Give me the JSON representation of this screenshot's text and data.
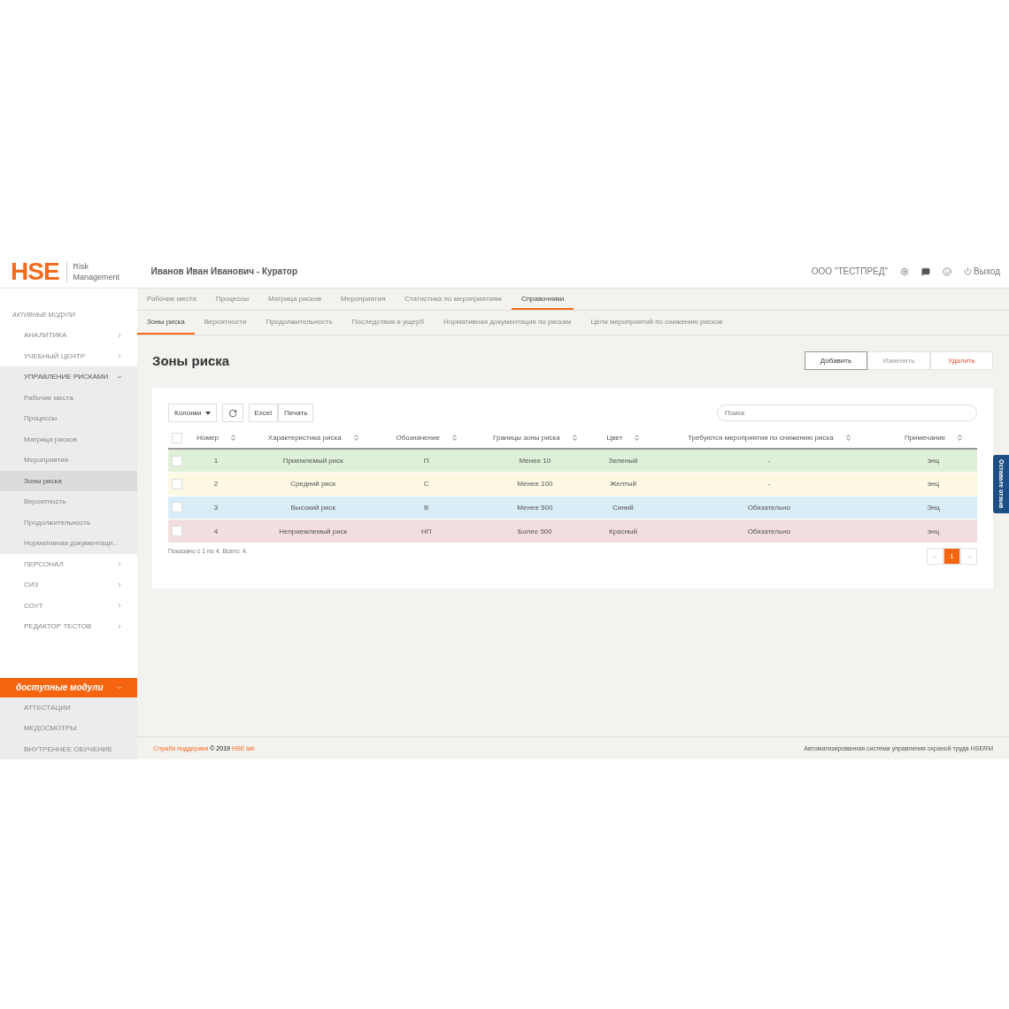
{
  "header": {
    "logo": "HSE",
    "logo_sub": "Risk Management",
    "user": "Иванов Иван Иванович - Куратор",
    "org": "ООО \"ТЕСТПРЕД\"",
    "logout": "Выход"
  },
  "sidebar": {
    "title": "АКТИВНЫЕ МОДУЛИ",
    "items": [
      {
        "label": "АНАЛИТИКА",
        "expanded": false
      },
      {
        "label": "УЧЕБНЫЙ ЦЕНТР",
        "expanded": false
      },
      {
        "label": "УПРАВЛЕНИЕ РИСКАМИ",
        "expanded": true,
        "children": [
          {
            "label": "Рабочие места",
            "selected": false
          },
          {
            "label": "Процессы",
            "selected": false
          },
          {
            "label": "Матрица рисков",
            "selected": false
          },
          {
            "label": "Мероприятия",
            "selected": false
          },
          {
            "label": "Зоны риска",
            "selected": true
          },
          {
            "label": "Вероятность",
            "selected": false
          },
          {
            "label": "Продолжительность",
            "selected": false
          },
          {
            "label": "Нормативная документаци...",
            "selected": false
          }
        ]
      },
      {
        "label": "ПЕРСОНАЛ",
        "expanded": false
      },
      {
        "label": "СИЗ",
        "expanded": false
      },
      {
        "label": "СОУТ",
        "expanded": false
      },
      {
        "label": "РЕДАКТОР ТЕСТОВ",
        "expanded": false
      }
    ],
    "available": {
      "title": "доступные модули",
      "items": [
        "АТТЕСТАЦИИ",
        "МЕДОСМОТРЫ",
        "ВНУТРЕННЕЕ ОБУЧЕНИЕ"
      ]
    }
  },
  "tabs": [
    {
      "label": "Рабочие места",
      "selected": false
    },
    {
      "label": "Процессы",
      "selected": false
    },
    {
      "label": "Матрица рисков",
      "selected": false
    },
    {
      "label": "Мероприятия",
      "selected": false
    },
    {
      "label": "Статистика по мероприятиям",
      "selected": false
    },
    {
      "label": "Справочники",
      "selected": true
    }
  ],
  "subtabs": [
    {
      "label": "Зоны риска",
      "selected": true
    },
    {
      "label": "Вероятности",
      "selected": false
    },
    {
      "label": "Продолжительность",
      "selected": false
    },
    {
      "label": "Последствия и ущерб",
      "selected": false
    },
    {
      "label": "Нормативная документация по рискам",
      "selected": false
    },
    {
      "label": "Цели мероприятий по снижению рисков",
      "selected": false
    }
  ],
  "page_title": "Зоны риска",
  "actions": [
    {
      "label": "Добавить",
      "kind": "primary"
    },
    {
      "label": "Изменить",
      "kind": "muted"
    },
    {
      "label": "Удалить",
      "kind": "danger"
    }
  ],
  "toolbar": {
    "columns": "Колонки",
    "excel": "Excel",
    "print": "Печать",
    "search_placeholder": "Поиск"
  },
  "table": {
    "select_all_checked": false,
    "columns": [
      "Номер",
      "Характеристика риска",
      "Обозначение",
      "Границы зоны риска",
      "Цвет",
      "Требуются мероприятия по снижению риска",
      "Примечание"
    ],
    "rows": [
      {
        "cells": [
          "1",
          "Приемлемый риск",
          "П",
          "Менее 10",
          "Зеленый",
          "-",
          "энц"
        ],
        "color": "#dff0d8",
        "checked": false
      },
      {
        "cells": [
          "2",
          "Средний риск",
          "С",
          "Менее 100",
          "Желтый",
          "-",
          "энц"
        ],
        "color": "#fcf8e3",
        "checked": false
      },
      {
        "cells": [
          "3",
          "Высокий риск",
          "В",
          "Менее 500",
          "Синий",
          "Обязательно",
          "Энц"
        ],
        "color": "#d9edf7",
        "checked": false
      },
      {
        "cells": [
          "4",
          "Неприемлемый риск",
          "НП",
          "Более 500",
          "Красный",
          "Обязательно",
          "энц"
        ],
        "color": "#f2dede",
        "checked": false
      }
    ]
  },
  "summary": "Показано с 1 по 4. Всего: 4.",
  "pagination": {
    "prev": "←",
    "pages": [
      {
        "label": "1",
        "selected": true
      }
    ],
    "next": "→"
  },
  "footer": {
    "support": "Служба поддержки",
    "copyright": "© 2019",
    "brand": "HSE lab",
    "system": "Автоматизированная система управления охраной труда HSERM"
  },
  "feedback": "Оставьте отзыв"
}
